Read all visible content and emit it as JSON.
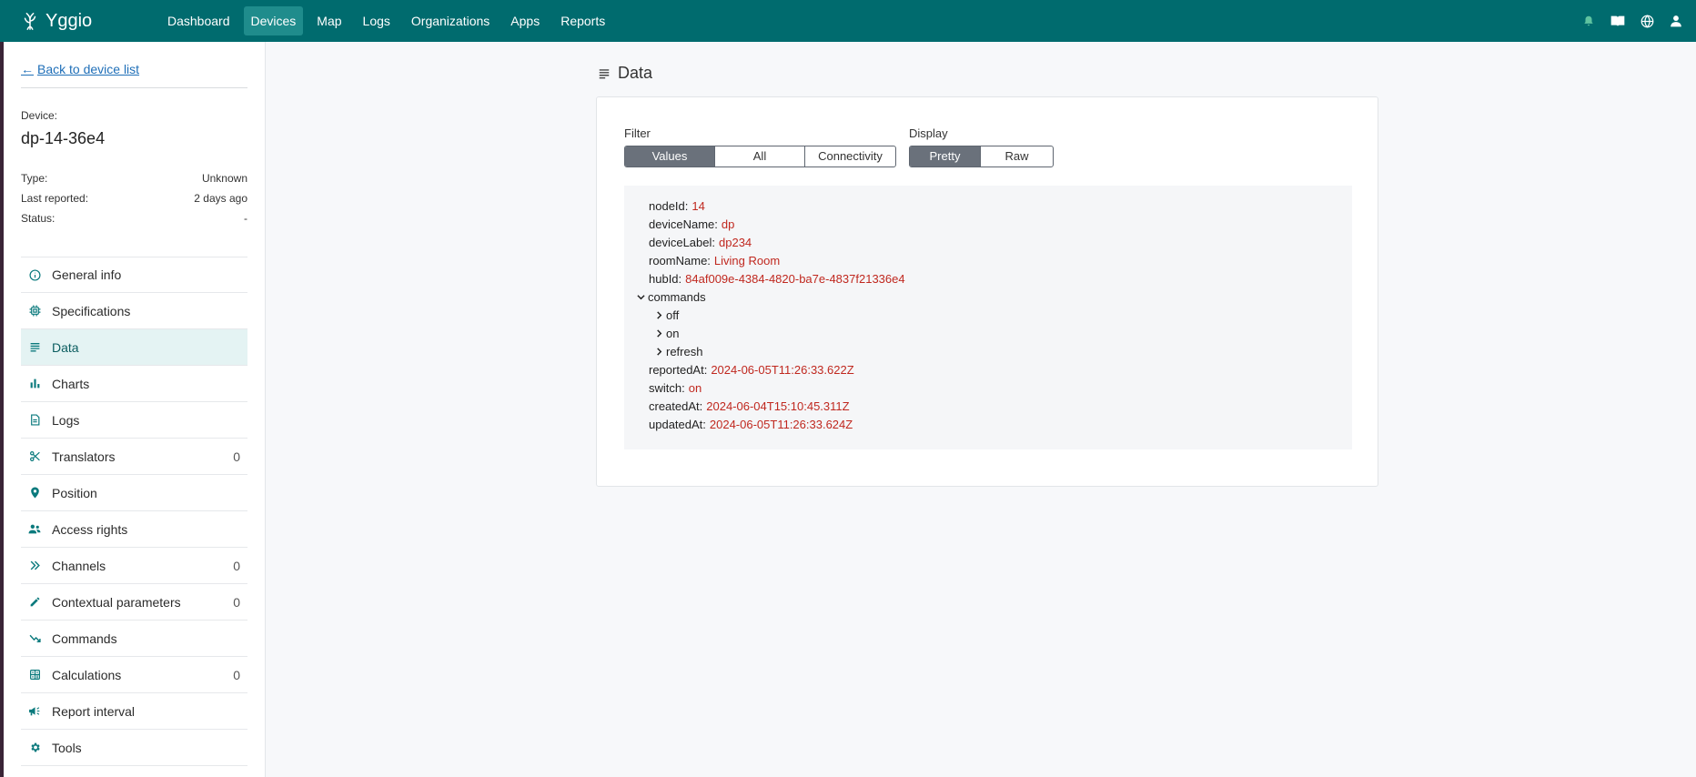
{
  "app": {
    "name": "Yggio"
  },
  "nav": {
    "items": [
      "Dashboard",
      "Devices",
      "Map",
      "Logs",
      "Organizations",
      "Apps",
      "Reports"
    ],
    "active": "Devices"
  },
  "nav_icons": [
    "bell-icon",
    "book-icon",
    "globe-icon",
    "user-icon"
  ],
  "sidebar": {
    "back_label": "Back to device list",
    "device_label": "Device:",
    "device_name": "dp-14-36e4",
    "meta": [
      {
        "label": "Type:",
        "value": "Unknown"
      },
      {
        "label": "Last reported:",
        "value": "2 days ago"
      },
      {
        "label": "Status:",
        "value": "-"
      }
    ],
    "menu": [
      {
        "label": "General info",
        "icon": "info-icon",
        "count": ""
      },
      {
        "label": "Specifications",
        "icon": "chip-icon",
        "count": ""
      },
      {
        "label": "Data",
        "icon": "lines-icon",
        "count": "",
        "active": true
      },
      {
        "label": "Charts",
        "icon": "bar-chart-icon",
        "count": ""
      },
      {
        "label": "Logs",
        "icon": "document-icon",
        "count": ""
      },
      {
        "label": "Translators",
        "icon": "scissors-icon",
        "count": "0"
      },
      {
        "label": "Position",
        "icon": "map-pin-icon",
        "count": ""
      },
      {
        "label": "Access rights",
        "icon": "users-icon",
        "count": ""
      },
      {
        "label": "Channels",
        "icon": "double-chevron-icon",
        "count": "0"
      },
      {
        "label": "Contextual parameters",
        "icon": "pencil-icon",
        "count": "0"
      },
      {
        "label": "Commands",
        "icon": "trend-icon",
        "count": ""
      },
      {
        "label": "Calculations",
        "icon": "calculator-icon",
        "count": "0"
      },
      {
        "label": "Report interval",
        "icon": "megaphone-icon",
        "count": ""
      },
      {
        "label": "Tools",
        "icon": "gear-icon",
        "count": ""
      }
    ]
  },
  "main": {
    "title": "Data",
    "filter": {
      "label": "Filter",
      "options": [
        "Values",
        "All",
        "Connectivity"
      ],
      "selected": "Values"
    },
    "display": {
      "label": "Display",
      "options": [
        "Pretty",
        "Raw"
      ],
      "selected": "Pretty"
    },
    "data": {
      "nodeId": "14",
      "deviceName": "dp",
      "deviceLabel": "dp234",
      "roomName": "Living Room",
      "hubId": "84af009e-4384-4820-ba7e-4837f21336e4",
      "commands": [
        "off",
        "on",
        "refresh"
      ],
      "reportedAt": "2024-06-05T11:26:33.622Z",
      "switch": "on",
      "createdAt": "2024-06-04T15:10:45.311Z",
      "updatedAt": "2024-06-05T11:26:33.624Z"
    },
    "keys": {
      "nodeId": "nodeId:",
      "deviceName": "deviceName:",
      "deviceLabel": "deviceLabel:",
      "roomName": "roomName:",
      "hubId": "hubId:",
      "commands": "commands",
      "reportedAt": "reportedAt:",
      "switch": "switch:",
      "createdAt": "createdAt:",
      "updatedAt": "updatedAt:"
    }
  },
  "colors": {
    "topbar": "#006b6e",
    "active_nav": "#1f8c8c",
    "value_red": "#c0281f",
    "teal": "#0b7a7d"
  }
}
